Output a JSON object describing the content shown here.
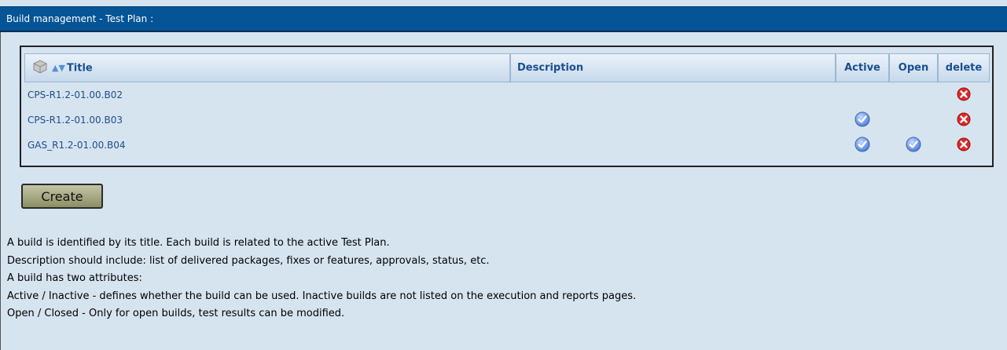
{
  "header": {
    "title": "Build management - Test Plan :"
  },
  "table": {
    "columns": {
      "title": "Title",
      "description": "Description",
      "active": "Active",
      "open": "Open",
      "delete": "delete"
    },
    "rows": [
      {
        "title": "CPS-R1.2-01.00.B02",
        "description": "",
        "active": false,
        "open": false
      },
      {
        "title": "CPS-R1.2-01.00.B03",
        "description": "",
        "active": true,
        "open": false
      },
      {
        "title": "GAS_R1.2-01.00.B04",
        "description": "",
        "active": true,
        "open": true
      }
    ]
  },
  "create_button": {
    "label": "Create"
  },
  "help": {
    "lines": [
      "A build is identified by its title. Each build is related to the active Test Plan.",
      "Description should include: list of delivered packages, fixes or features, approvals, status, etc.",
      "A build has two attributes:",
      "Active / Inactive - defines whether the build can be used. Inactive builds are not listed on the execution and reports pages.",
      "Open / Closed - Only for open builds, test results can be modified."
    ]
  },
  "icons": {
    "header_toggle": "cube-toggle-icon",
    "sort": "sort-arrows-icon",
    "active": "check-circle-icon",
    "open": "check-circle-icon",
    "delete": "delete-x-icon"
  },
  "colors": {
    "title_bar": "#045496",
    "background": "#d6e4f0",
    "link_text": "#1f4d87",
    "delete_red": "#d92a2a",
    "check_blue": "#5c8fe0"
  }
}
